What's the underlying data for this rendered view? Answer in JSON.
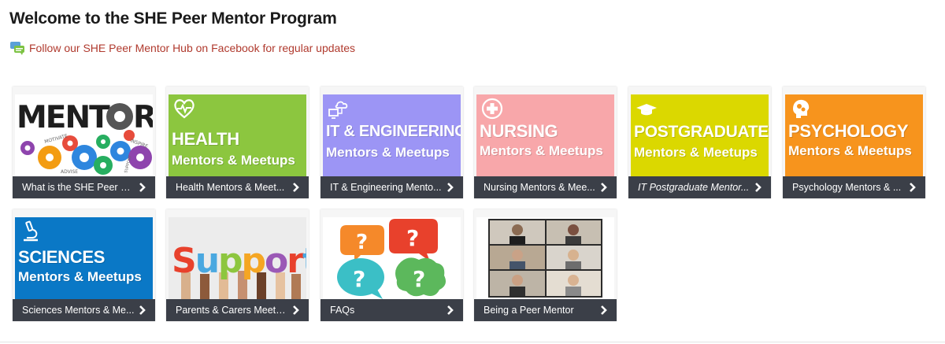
{
  "header": {
    "title": "Welcome to the SHE Peer Mentor Program",
    "facebook_link": "Follow our SHE Peer Mentor Hub on Facebook for regular updates"
  },
  "tiles": [
    {
      "label": "What is the SHE Peer M...",
      "image": {
        "type": "mentor-logo",
        "word": "MENTOR",
        "gear_words": [
          "MOTIVATE",
          "INSPIRE",
          "ADVISE",
          "SUPPORT"
        ]
      }
    },
    {
      "label": "Health Mentors & Meet...",
      "image": {
        "type": "category",
        "color": "#8cc63f",
        "icon": "heartbeat-icon",
        "title": "HEALTH",
        "subtitle": "Mentors & Meetups"
      }
    },
    {
      "label": "IT & Engineering Mento...",
      "image": {
        "type": "category",
        "color": "#9c95f5",
        "icon": "cloud-computer-icon",
        "title": "IT & ENGINEERING",
        "subtitle": "Mentors & Meetups"
      }
    },
    {
      "label": "Nursing Mentors & Mee...",
      "image": {
        "type": "category",
        "color": "#f8a7aa",
        "icon": "medical-cross-icon",
        "title": "NURSING",
        "subtitle": "Mentors & Meetups"
      }
    },
    {
      "label": "IT Postgraduate Mentor...",
      "image": {
        "type": "category",
        "color": "#dbd800",
        "icon": "graduation-cap-icon",
        "title": "POSTGRADUATE",
        "subtitle": "Mentors & Meetups"
      }
    },
    {
      "label": "Psychology Mentors & ...",
      "image": {
        "type": "category",
        "color": "#f7941d",
        "icon": "brain-gears-icon",
        "title": "PSYCHOLOGY",
        "subtitle": "Mentors & Meetups"
      }
    },
    {
      "label": "Sciences Mentors & Me...",
      "image": {
        "type": "category",
        "color": "#0a78c6",
        "icon": "microscope-icon",
        "title": "SCIENCES",
        "subtitle": "Mentors & Meetups"
      }
    },
    {
      "label": "Parents & Carers Meetu...",
      "image": {
        "type": "support-photo",
        "word": "Support",
        "letter_colors": [
          "#e8412c",
          "#4aa8e0",
          "#8dc63f",
          "#f5a623",
          "#9b59b6",
          "#e8412c",
          "#4aa8e0"
        ]
      }
    },
    {
      "label": "FAQs",
      "image": {
        "type": "faq-bubbles",
        "colors": [
          "#f5892a",
          "#e8412c",
          "#3bbfc6",
          "#5cb85c"
        ]
      }
    },
    {
      "label": "Being a Peer Mentor",
      "image": {
        "type": "video-call-grid"
      }
    }
  ],
  "colors": {
    "title": "#1b1b1b",
    "link": "#b03a2e",
    "bar": "#3b3f48"
  }
}
